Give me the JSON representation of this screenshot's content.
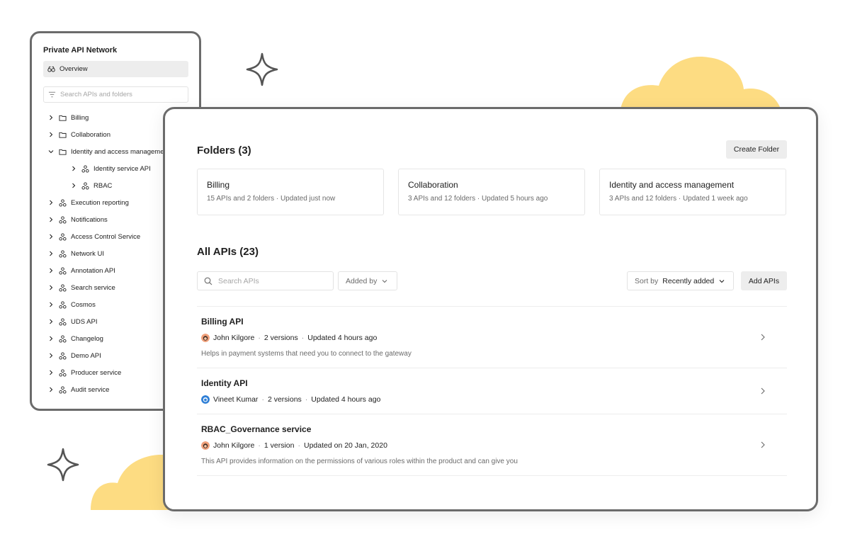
{
  "sidebar": {
    "title": "Private API Network",
    "overview_label": "Overview",
    "search_placeholder": "Search APIs and folders",
    "tree": [
      {
        "label": "Billing",
        "type": "folder",
        "level": 0,
        "expanded": false
      },
      {
        "label": "Collaboration",
        "type": "folder",
        "level": 0,
        "expanded": false
      },
      {
        "label": "Identity and access management",
        "type": "folder",
        "level": 0,
        "expanded": true
      },
      {
        "label": "Identity service API",
        "type": "api",
        "level": 1,
        "expanded": false
      },
      {
        "label": "RBAC",
        "type": "api",
        "level": 1,
        "expanded": false
      },
      {
        "label": "Execution reporting",
        "type": "api",
        "level": 0,
        "expanded": false
      },
      {
        "label": "Notifications",
        "type": "api",
        "level": 0,
        "expanded": false
      },
      {
        "label": "Access Control Service",
        "type": "api",
        "level": 0,
        "expanded": false
      },
      {
        "label": "Network UI",
        "type": "api",
        "level": 0,
        "expanded": false
      },
      {
        "label": "Annotation API",
        "type": "api",
        "level": 0,
        "expanded": false
      },
      {
        "label": "Search service",
        "type": "api",
        "level": 0,
        "expanded": false
      },
      {
        "label": "Cosmos",
        "type": "api",
        "level": 0,
        "expanded": false
      },
      {
        "label": "UDS API",
        "type": "api",
        "level": 0,
        "expanded": false
      },
      {
        "label": "Changelog",
        "type": "api",
        "level": 0,
        "expanded": false
      },
      {
        "label": "Demo API",
        "type": "api",
        "level": 0,
        "expanded": false
      },
      {
        "label": "Producer service",
        "type": "api",
        "level": 0,
        "expanded": false
      },
      {
        "label": "Audit service",
        "type": "api",
        "level": 0,
        "expanded": false
      }
    ]
  },
  "folders": {
    "title": "Folders (3)",
    "create_label": "Create Folder",
    "items": [
      {
        "name": "Billing",
        "meta": "15 APIs and 2 folders  ·  Updated just now"
      },
      {
        "name": "Collaboration",
        "meta": "3 APIs and 12 folders  ·  Updated 5 hours ago"
      },
      {
        "name": "Identity and access management",
        "meta": "3 APIs and 12 folders  ·  Updated 1 week ago"
      }
    ]
  },
  "apis": {
    "title": "All APIs (23)",
    "search_placeholder": "Search APIs",
    "added_by_label": "Added by",
    "sort_prefix": "Sort by",
    "sort_value": "Recently added",
    "add_label": "Add APIs",
    "items": [
      {
        "name": "Billing API",
        "author": "John Kilgore",
        "versions": "2 versions",
        "updated": "Updated 4 hours ago",
        "description": "Helps in payment systems that need you to connect to the gateway",
        "avatar": "john"
      },
      {
        "name": "Identity API",
        "author": "Vineet Kumar",
        "versions": "2 versions",
        "updated": "Updated 4 hours ago",
        "description": "",
        "avatar": "vineet"
      },
      {
        "name": "RBAC_Governance service",
        "author": "John Kilgore",
        "versions": "1 version",
        "updated": "Updated on 20 Jan, 2020",
        "description": "This API provides information on the permissions of various roles within the product and can give you",
        "avatar": "john"
      }
    ]
  },
  "colors": {
    "cloud": "#fddc82",
    "border": "#6b6b6b",
    "button_bg": "#ededed"
  },
  "icons": {
    "overview": "binoculars-icon",
    "search": "search-icon",
    "filter": "filter-icon",
    "folder": "folder-icon",
    "api": "api-nodes-icon",
    "chevron_right": "chevron-right-icon",
    "chevron_down": "chevron-down-icon",
    "sparkle": "sparkle-icon"
  }
}
